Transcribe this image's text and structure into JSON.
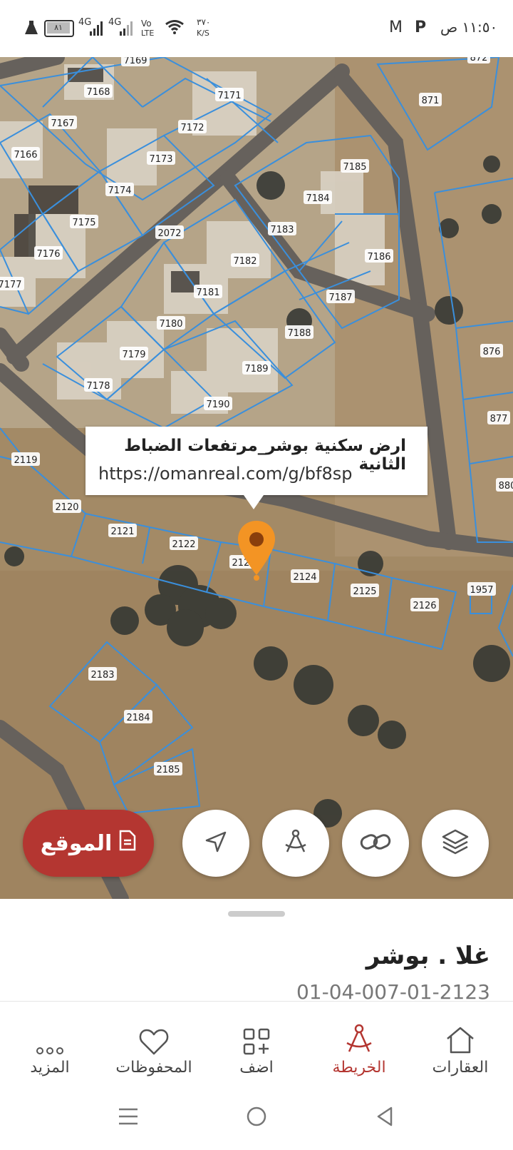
{
  "status_bar": {
    "time": "١١:٥٠ ص",
    "speed": "٣٧٠",
    "speed_unit": "K/S",
    "battery": "٨١",
    "net1": "4G",
    "net2": "4G",
    "volte_top": "Vo",
    "volte_bottom": "LTE"
  },
  "map": {
    "parcels": [
      {
        "label": "7169"
      },
      {
        "label": "7168"
      },
      {
        "label": "7171"
      },
      {
        "label": "7167"
      },
      {
        "label": "7172"
      },
      {
        "label": "7166"
      },
      {
        "label": "7173"
      },
      {
        "label": "7174"
      },
      {
        "label": "7175"
      },
      {
        "label": "7176"
      },
      {
        "label": "7177"
      },
      {
        "label": "2072"
      },
      {
        "label": "7185"
      },
      {
        "label": "7184"
      },
      {
        "label": "7183"
      },
      {
        "label": "7182"
      },
      {
        "label": "7186"
      },
      {
        "label": "7181"
      },
      {
        "label": "7187"
      },
      {
        "label": "7180"
      },
      {
        "label": "7188"
      },
      {
        "label": "7179"
      },
      {
        "label": "7189"
      },
      {
        "label": "7178"
      },
      {
        "label": "7190"
      },
      {
        "label": "871"
      },
      {
        "label": "876"
      },
      {
        "label": "877"
      },
      {
        "label": "880"
      },
      {
        "label": "2119"
      },
      {
        "label": "2120"
      },
      {
        "label": "2121"
      },
      {
        "label": "2122"
      },
      {
        "label": "2123"
      },
      {
        "label": "2124"
      },
      {
        "label": "2125"
      },
      {
        "label": "2126"
      },
      {
        "label": "1957"
      },
      {
        "label": "2183"
      },
      {
        "label": "2184"
      },
      {
        "label": "2185"
      },
      {
        "label": "872"
      }
    ],
    "tooltip": {
      "title": "ارض سكنية بوشر_مرتفعات الضباط الثانية",
      "url": "https://omanreal.com/g/bf8sp"
    },
    "pin_color": "#f39424",
    "parcel_line_color": "#3a8fdc"
  },
  "actions": {
    "location_label": "الموقع",
    "location_color": "#b43631",
    "buttons": [
      {
        "icon": "layers-icon"
      },
      {
        "icon": "link-icon"
      },
      {
        "icon": "compass-icon"
      },
      {
        "icon": "navigate-icon"
      }
    ]
  },
  "sheet": {
    "title": "غلا . بوشر",
    "code": "01-04-007-01-2123"
  },
  "bottom_nav": {
    "items": [
      {
        "label": "العقارات",
        "icon": "home-icon"
      },
      {
        "label": "الخريطة",
        "icon": "compass-icon",
        "active": true
      },
      {
        "label": "اضف",
        "icon": "add-grid-icon"
      },
      {
        "label": "المحفوظات",
        "icon": "heart-icon"
      },
      {
        "label": "المزيد",
        "icon": "more-icon"
      }
    ]
  }
}
